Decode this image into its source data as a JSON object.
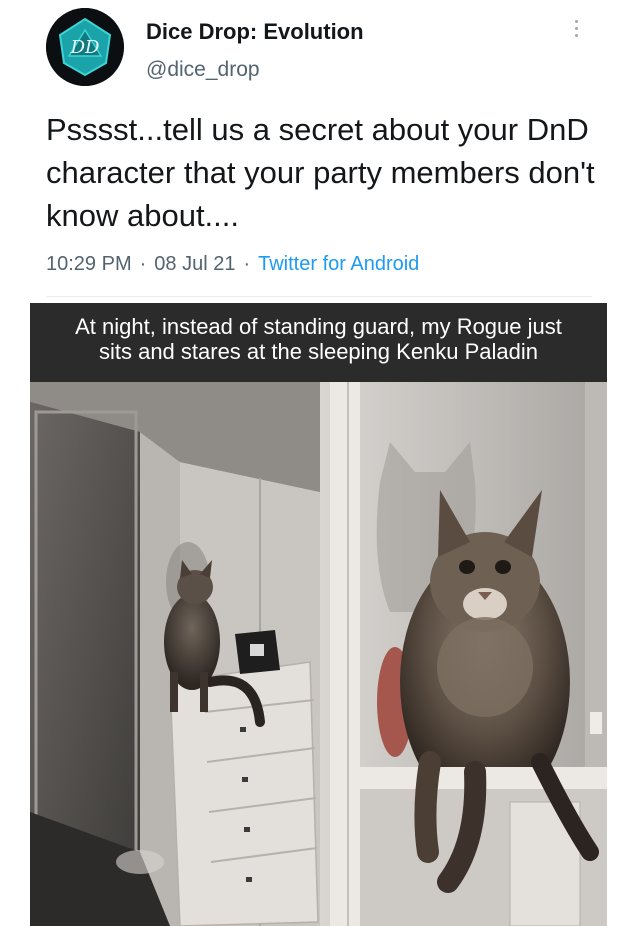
{
  "tweet": {
    "display_name": "Dice Drop: Evolution",
    "handle": "@dice_drop",
    "avatar_initials": "DD",
    "avatar_icon": "d20-dice-logo",
    "text": "Psssst...tell us a secret about your DnD character that your party members don't know about....",
    "time": "10:29 PM",
    "date": "08 Jul 21",
    "source": "Twitter for Android",
    "more_icon": "more-vertical-icon"
  },
  "meme": {
    "caption_line1": "At night, instead of standing guard, my Rogue just",
    "caption_line2": "sits and stares at the sleeping Kenku Paladin",
    "photo": "Two photos: a long-haired Maine Coon cat sitting on a dresser in a hallway corner, and a close-up of the same cat staring at the camera"
  },
  "colors": {
    "text": "#14171a",
    "secondary": "#536471",
    "link": "#1d9bf0",
    "caption_bg": "#2b2b2b"
  }
}
